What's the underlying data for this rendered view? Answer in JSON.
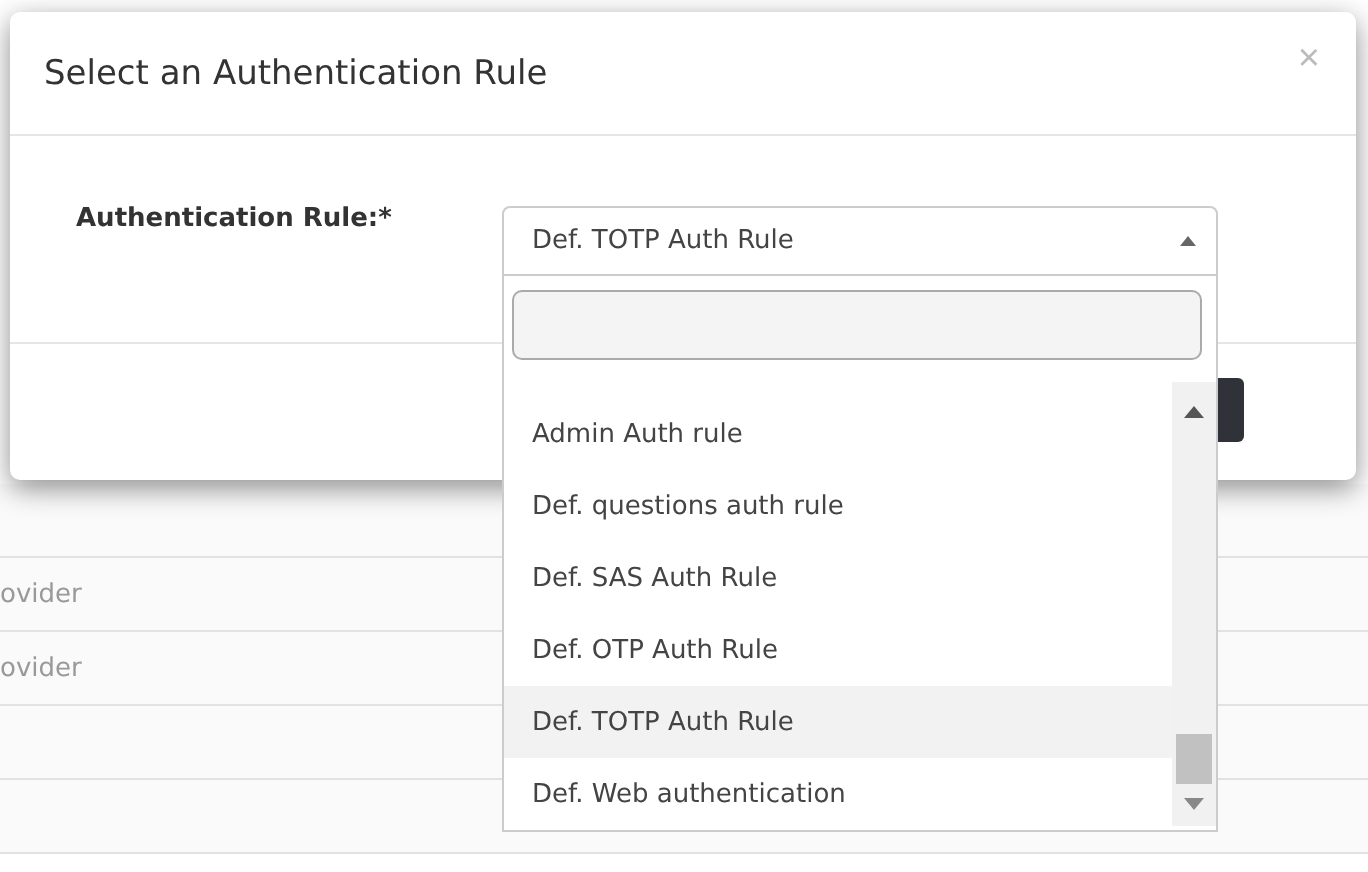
{
  "background_rows": [
    {
      "text": ""
    },
    {
      "text": "ovider"
    },
    {
      "text": "ovider"
    },
    {
      "text": ""
    },
    {
      "text": ""
    }
  ],
  "dialog": {
    "title": "Select an Authentication Rule",
    "close": "×",
    "field": {
      "label": "Authentication Rule:*",
      "value": "Def. TOTP Auth Rule",
      "expanded": true
    },
    "options": [
      {
        "label": "Admin Auth rule",
        "selected": false
      },
      {
        "label": "Def. questions auth rule",
        "selected": false
      },
      {
        "label": "Def. SAS Auth Rule",
        "selected": false
      },
      {
        "label": "Def. OTP Auth Rule",
        "selected": false
      },
      {
        "label": "Def. TOTP Auth Rule",
        "selected": true
      },
      {
        "label": "Def. Web authentication",
        "selected": false
      }
    ]
  }
}
